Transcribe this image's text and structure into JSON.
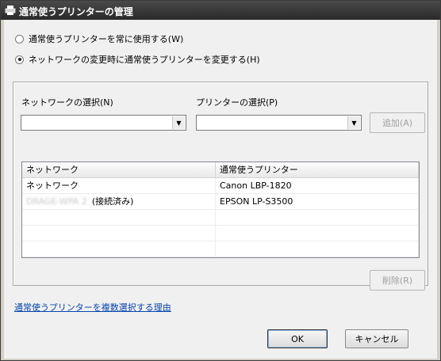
{
  "window": {
    "title": "通常使うプリンターの管理",
    "icon": "printer-icon"
  },
  "options": [
    {
      "label": "通常使うプリンターを常に使用する(W)",
      "checked": false
    },
    {
      "label": "ネットワークの変更時に通常使うプリンターを変更する(H)",
      "checked": true
    }
  ],
  "network_select": {
    "label": "ネットワークの選択(N)",
    "value": ""
  },
  "printer_select": {
    "label": "プリンターの選択(P)",
    "value": ""
  },
  "add_button": {
    "label": "追加(A)",
    "enabled": false
  },
  "table": {
    "columns": [
      "ネットワーク",
      "通常使うプリンター"
    ],
    "rows": [
      {
        "network": "ネットワーク",
        "network_suffix": "",
        "printer": "Canon LBP-1820"
      },
      {
        "network": "DRAGE-WPA 2",
        "network_suffix": "(接続済み)",
        "printer": "EPSON LP-S3500"
      }
    ]
  },
  "remove_button": {
    "label": "削除(R)",
    "enabled": false
  },
  "help_link": "通常使うプリンターを複数選択する理由",
  "ok_button": "OK",
  "cancel_button": "キャンセル"
}
